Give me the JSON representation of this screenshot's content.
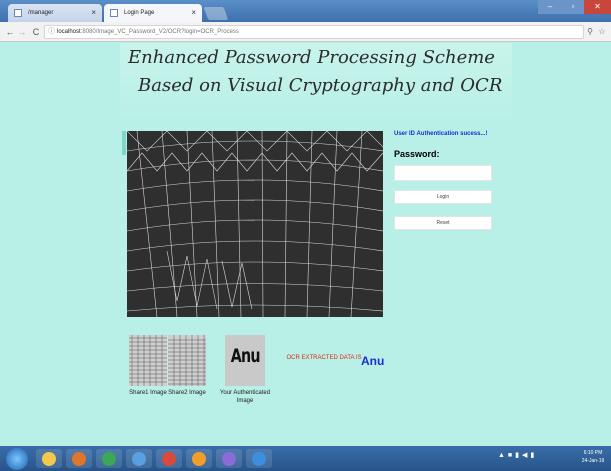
{
  "browser": {
    "tabs": [
      {
        "label": "/manager"
      },
      {
        "label": "Login Page"
      }
    ],
    "new_tab_icon": "new-tab-icon",
    "address": {
      "host": "localhost",
      "rest": ":8080/Image_VC_Password_V2/OCR?login=OCR_Process"
    }
  },
  "page": {
    "title": "Enhanced Password Processing Scheme",
    "subtitle": "Based on Visual Cryptography and OCR",
    "auth_message": "User ID Authentication sucess...!",
    "password_label": "Password:",
    "password_value": "",
    "login_label": "Login",
    "reset_label": "Reset",
    "share1_caption": "Share1 Image",
    "share2_caption": "Share2 Image",
    "authenticated_caption": "Your Authenticated Image",
    "authenticated_image_text": "Anu",
    "ocr_label": "OCR EXTRACTED DATA IS",
    "ocr_value": "Anu"
  },
  "taskbar": {
    "time": "6:10 PM",
    "date": "24-Jan-19"
  },
  "colors": {
    "page_bg": "#b8efe6",
    "auth_message": "#1a2fd0",
    "ocr_label": "#e0281c",
    "ocr_value": "#1a2fd0"
  }
}
